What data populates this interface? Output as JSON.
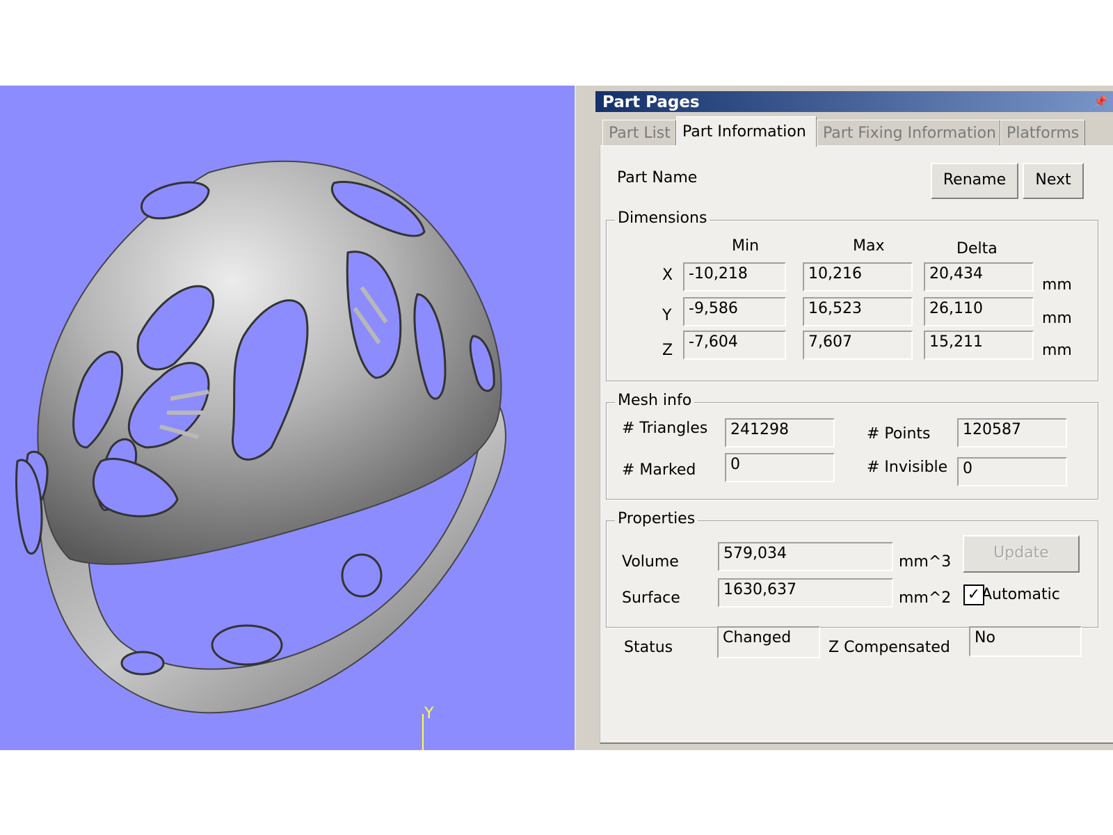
{
  "viewport": {
    "axis_label": "Y",
    "background": "#8c8cff"
  },
  "panel": {
    "title": "Part Pages",
    "pin_icon": "pin-icon",
    "tabs": [
      {
        "label": "Part List",
        "active": false
      },
      {
        "label": "Part Information",
        "active": true
      },
      {
        "label": "Part Fixing Information",
        "active": false
      },
      {
        "label": "Platforms",
        "active": false
      }
    ]
  },
  "part": {
    "name_label": "Part Name",
    "rename_label": "Rename",
    "next_label": "Next"
  },
  "dimensions": {
    "legend": "Dimensions",
    "headers": {
      "min": "Min",
      "max": "Max",
      "delta": "Delta"
    },
    "rows": [
      {
        "axis": "X",
        "min": "-10,218",
        "max": "10,216",
        "delta": "20,434",
        "unit": "mm"
      },
      {
        "axis": "Y",
        "min": "-9,586",
        "max": "16,523",
        "delta": "26,110",
        "unit": "mm"
      },
      {
        "axis": "Z",
        "min": "-7,604",
        "max": "7,607",
        "delta": "15,211",
        "unit": "mm"
      }
    ]
  },
  "mesh": {
    "legend": "Mesh info",
    "triangles_label": "# Triangles",
    "triangles": "241298",
    "points_label": "# Points",
    "points": "120587",
    "marked_label": "# Marked",
    "marked": "0",
    "invisible_label": "# Invisible",
    "invisible": "0"
  },
  "properties": {
    "legend": "Properties",
    "volume_label": "Volume",
    "volume": "579,034",
    "volume_unit": "mm^3",
    "surface_label": "Surface",
    "surface": "1630,637",
    "surface_unit": "mm^2",
    "update_label": "Update",
    "automatic_label": "Automatic",
    "automatic_checked": true
  },
  "status": {
    "status_label": "Status",
    "status_value": "Changed",
    "zcomp_label": "Z Compensated",
    "zcomp_value": "No"
  }
}
